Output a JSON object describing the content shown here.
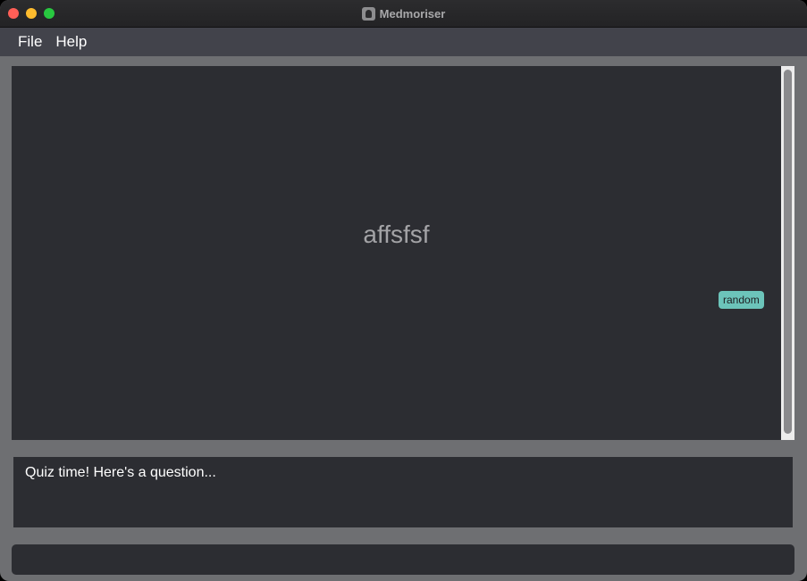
{
  "window": {
    "title": "Medmoriser"
  },
  "menu": {
    "items": [
      "File",
      "Help"
    ]
  },
  "display": {
    "question": "affsfsf",
    "tag": "random"
  },
  "result": {
    "text": "Quiz time! Here's a question..."
  },
  "command": {
    "value": "",
    "placeholder": ""
  },
  "colors": {
    "accent_tag": "#6cc4ba",
    "panel": "#2c2d32",
    "menubar": "#42434b"
  }
}
